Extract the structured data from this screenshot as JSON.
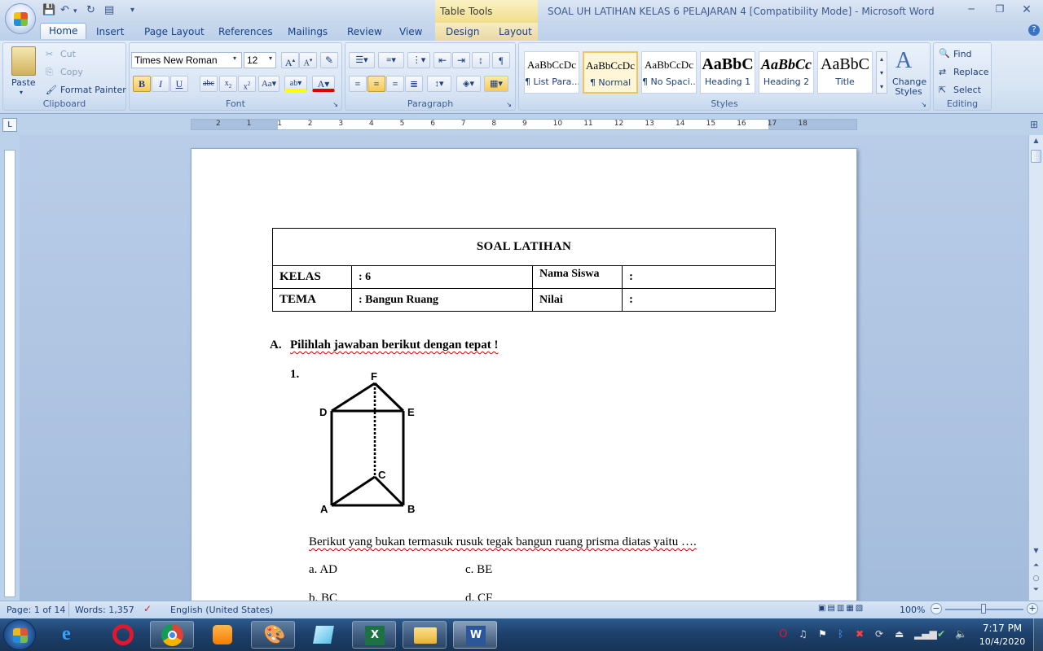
{
  "titlebar": {
    "contextual_tab_group": "Table Tools",
    "document_title": "SOAL UH LATIHAN KELAS 6  PELAJARAN 4 [Compatibility Mode] - Microsoft Word"
  },
  "tabs": [
    "Home",
    "Insert",
    "Page Layout",
    "References",
    "Mailings",
    "Review",
    "View",
    "Design",
    "Layout"
  ],
  "clipboard": {
    "paste": "Paste",
    "cut": "Cut",
    "copy": "Copy",
    "format_painter": "Format Painter",
    "label": "Clipboard"
  },
  "font": {
    "name": "Times New Roman",
    "size": "12",
    "label": "Font"
  },
  "paragraph": {
    "label": "Paragraph"
  },
  "styles": {
    "label": "Styles",
    "items": [
      {
        "preview": "AaBbCcDc",
        "name": "¶ List Para..."
      },
      {
        "preview": "AaBbCcDc",
        "name": "¶ Normal"
      },
      {
        "preview": "AaBbCcDc",
        "name": "¶ No Spaci..."
      },
      {
        "preview": "AaBbC",
        "name": "Heading 1"
      },
      {
        "preview": "AaBbCc",
        "name": "Heading 2"
      },
      {
        "preview": "AaBbC",
        "name": "Title"
      }
    ],
    "change_styles": "Change Styles"
  },
  "editing": {
    "find": "Find",
    "replace": "Replace",
    "select": "Select",
    "label": "Editing"
  },
  "ruler_h": [
    "2",
    "1",
    "1",
    "2",
    "3",
    "4",
    "5",
    "6",
    "7",
    "8",
    "9",
    "10",
    "11",
    "12",
    "13",
    "14",
    "15",
    "16",
    "17",
    "18"
  ],
  "document": {
    "header_title": "SOAL LATIHAN",
    "rows": [
      {
        "k1": "KELAS",
        "v1": ": 6",
        "k2": "Nama Siswa",
        "v2": ":"
      },
      {
        "k1": "TEMA",
        "v1": ": Bangun Ruang",
        "k2": "Nilai",
        "v2": ":"
      }
    ],
    "section_marker": "A.",
    "section_heading": "Pilihlah jawaban berikut dengan tepat !",
    "question_number": "1.",
    "figure_labels": {
      "F": "F",
      "D": "D",
      "E": "E",
      "C": "C",
      "A": "A",
      "B": "B"
    },
    "question_text": "Berikut yang bukan termasuk rusuk tegak bangun ruang prisma diatas yaitu ….",
    "options": {
      "a": "a. AD",
      "b": "b. BC",
      "c": "c. BE",
      "d": "d. CF"
    }
  },
  "status": {
    "page": "Page: 1 of 14",
    "words": "Words: 1,357",
    "language": "English (United States)",
    "zoom": "100%"
  },
  "taskbar": {
    "time": "7:17 PM",
    "date": "10/4/2020"
  }
}
